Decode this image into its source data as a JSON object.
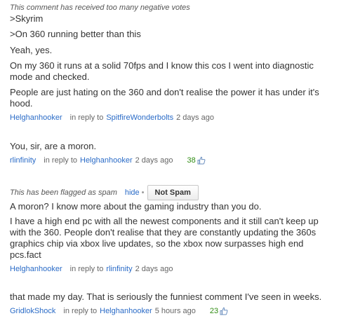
{
  "comment1": {
    "notice": "This comment has received too many negative votes",
    "lines": [
      ">Skyrim",
      ">On 360 running better than this",
      "Yeah, yes.",
      "On my 360 it runs at a solid 70fps and I know this cos I went into diagnostic",
      "mode and checked.",
      "People are just hating on the 360 and don't realise the power it has under it's",
      "hood."
    ],
    "author": "Helghanhooker",
    "in_reply_to": "in reply to",
    "reply_target": "SpitfireWonderbolts",
    "time": "2 days ago"
  },
  "comment2": {
    "lines": [
      "You, sir, are a moron."
    ],
    "author": "rlinfinity",
    "in_reply_to": "in reply to",
    "reply_target": "Helghanhooker",
    "time": "2 days ago",
    "likes": "38",
    "like_icon": "thumbs-up-icon"
  },
  "comment3": {
    "notice": "This has been flagged as spam",
    "hide_label": "hide",
    "bullet": "•",
    "not_spam_label": "Not Spam",
    "lines": [
      "A moron? I know more about the gaming industry than you do.",
      "I have a high end pc with all the newest components and it still can't keep up",
      "with the 360. People don't realise that they are constantly updating the 360s",
      "graphics chip via xbox live updates, so the xbox now surpasses high end",
      "pcs.fact"
    ],
    "author": "Helghanhooker",
    "in_reply_to": "in reply to",
    "reply_target": "rlinfinity",
    "time": "2 days ago"
  },
  "comment4": {
    "lines": [
      "that made my day. That is seriously the funniest comment I've seen in weeks."
    ],
    "author": "GridlokShock",
    "in_reply_to": "in reply to",
    "reply_target": "Helghanhooker",
    "time": "5 hours ago",
    "likes": "23",
    "like_icon": "thumbs-up-icon"
  },
  "colors": {
    "link": "#2a6bc7",
    "likes": "#2f8c12",
    "text": "#333333"
  }
}
